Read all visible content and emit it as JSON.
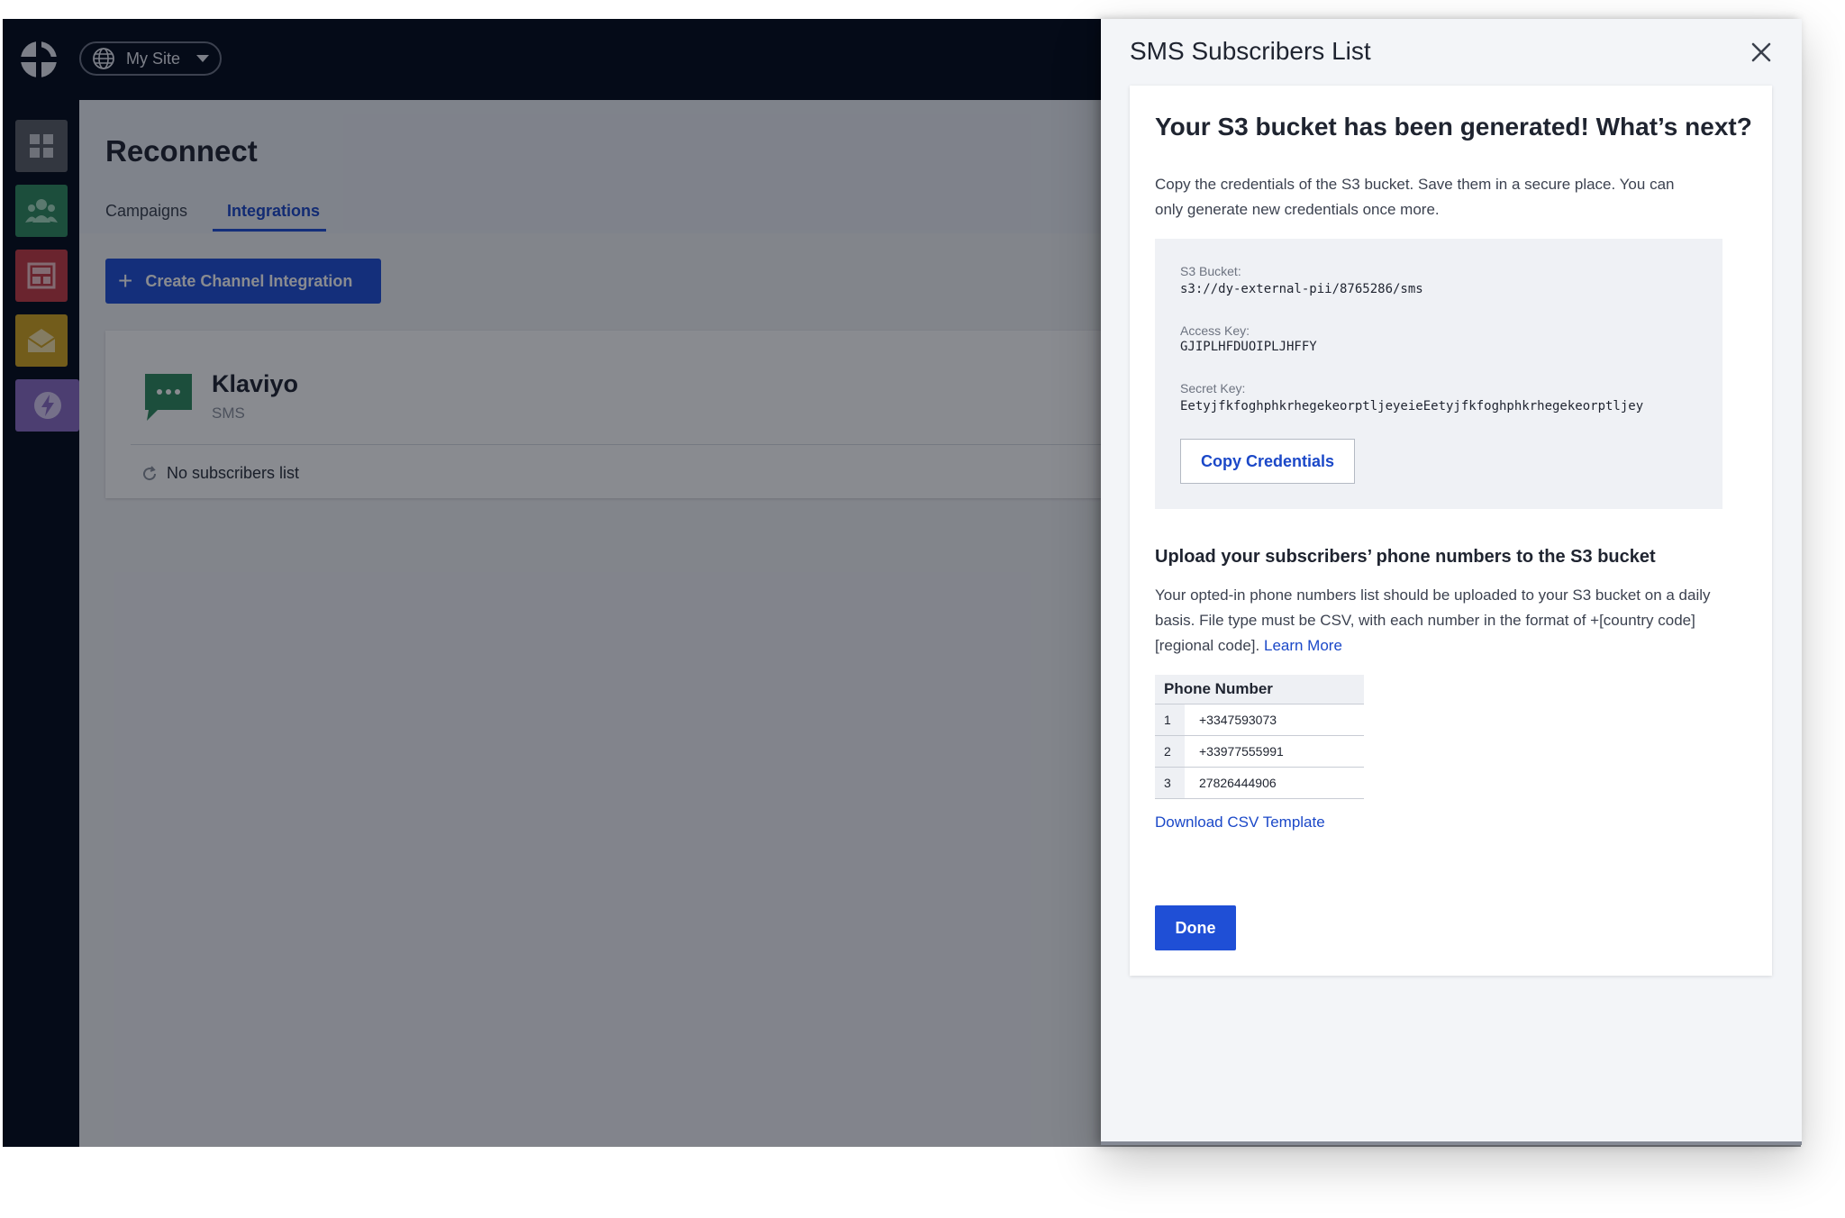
{
  "topbar": {
    "site_selector": {
      "label": "My Site",
      "icon": "globe-icon"
    }
  },
  "leftnav": {
    "items": [
      {
        "icon": "grid-icon",
        "color": "#5b5f67"
      },
      {
        "icon": "users-icon",
        "color": "#2e8a5e"
      },
      {
        "icon": "layout-icon",
        "color": "#c43a44"
      },
      {
        "icon": "envelope-icon",
        "color": "#d4a520"
      },
      {
        "icon": "lightning-icon",
        "color": "#8a6cc4",
        "active": true
      }
    ]
  },
  "main": {
    "title": "Reconnect",
    "tabs": [
      {
        "label": "Campaigns",
        "active": false
      },
      {
        "label": "Integrations",
        "active": true
      }
    ],
    "create_button_label": "Create Channel Integration",
    "integration_card": {
      "name": "Klaviyo",
      "type": "SMS",
      "status": "No subscribers list"
    }
  },
  "drawer": {
    "title": "SMS Subscribers List",
    "panel": {
      "heading": "Your S3 bucket has been generated! What’s next?",
      "description": "Copy the credentials of the S3 bucket. Save them in a secure place. You can only generate new credentials once more.",
      "credentials": {
        "bucket_label": "S3 Bucket:",
        "bucket_value": "s3://dy-external-pii/8765286/sms",
        "access_key_label": "Access Key:",
        "access_key_value": "GJIPLHFDUOIPLJHFFY",
        "secret_key_label": "Secret Key:",
        "secret_key_value": "EetyjfkfoghphkrhegekeorptljeyeieEetyjfkfoghphkrhegekeorptljey",
        "copy_button_label": "Copy Credentials"
      },
      "upload_heading": "Upload your subscribers’ phone numbers to the S3 bucket",
      "upload_description": "Your opted-in phone numbers list should be uploaded to your S3 bucket on a daily basis. File type must be CSV, with each number in the format of +[country code][regional code].",
      "learn_more_label": "Learn More",
      "table": {
        "header": "Phone Number",
        "rows": [
          {
            "index": "1",
            "number": "+3347593073"
          },
          {
            "index": "2",
            "number": "+33977555991"
          },
          {
            "index": "3",
            "number": "27826444906"
          }
        ]
      },
      "download_link_label": "Download CSV Template",
      "done_button_label": "Done"
    }
  },
  "colors": {
    "accent": "#1f4fd6",
    "dark_nav": "#030a19",
    "klaviyo_icon": "#2e8a5e"
  }
}
